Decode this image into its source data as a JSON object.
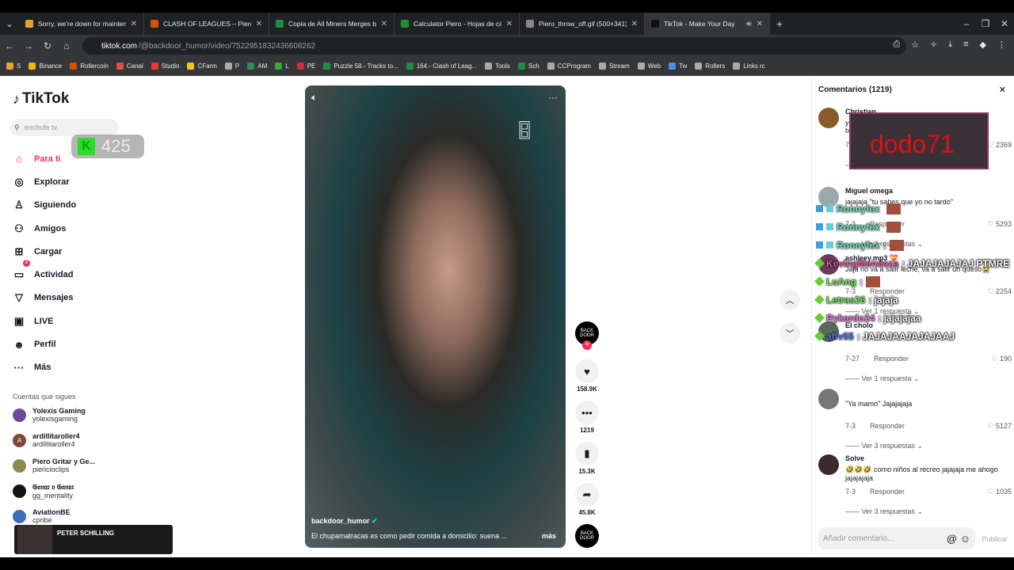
{
  "tabs": [
    {
      "title": "Sorry, we're down for mainten...",
      "color": "#e0a32e"
    },
    {
      "title": "CLASH OF LEAGUES – Piero",
      "color": "#d35400"
    },
    {
      "title": "Copia de All Miners Merges by",
      "color": "#1e8e3e"
    },
    {
      "title": "Calculator Piero - Hojas de cálc",
      "color": "#1e8e3e"
    },
    {
      "title": "Piero_throw_off.gif (500×341)",
      "color": "#888888"
    },
    {
      "title": "TikTok - Make Your Day",
      "color": "#111111"
    }
  ],
  "url": {
    "domain": "tiktok.com",
    "path": "/@backdoor_humor/video/7522951832436608262"
  },
  "bookmarks": [
    "S",
    "Binance",
    "Rollercoin",
    "Canal",
    "Studio",
    "CFarm",
    "P",
    "AM",
    "L",
    "PE",
    "Puzzle 58.- Tracks to...",
    "164.- Clash of Leag...",
    "Tools",
    "Sch",
    "CCProgram",
    "Stream",
    "Web",
    "Tw",
    "Rollers",
    "Links rc"
  ],
  "sidebar": {
    "logo": "TikTok",
    "search_placeholder": "enchufe tv",
    "menu": [
      {
        "label": "Para ti",
        "icon": "⌂"
      },
      {
        "label": "Explorar",
        "icon": "◎"
      },
      {
        "label": "Siguiendo",
        "icon": "♙"
      },
      {
        "label": "Amigos",
        "icon": "⚇"
      },
      {
        "label": "Cargar",
        "icon": "⊞"
      },
      {
        "label": "Actividad",
        "icon": "▭"
      },
      {
        "label": "Mensajes",
        "icon": "▽"
      },
      {
        "label": "LIVE",
        "icon": "▣"
      },
      {
        "label": "Perfil",
        "icon": "☻"
      },
      {
        "label": "Más",
        "icon": "···"
      }
    ],
    "activity_count": "2",
    "following_title": "Cuentas que sigues",
    "accounts": [
      {
        "name": "Yolexis Gaming",
        "handle": "yolexisgaming",
        "initial": "",
        "color": "#6a4c93"
      },
      {
        "name": "ardillitaroller4",
        "handle": "ardillitaroller4",
        "initial": "A",
        "color": "#7a4a3a"
      },
      {
        "name": "Piero Gritar y Ge...",
        "handle": "piericioclips",
        "initial": "",
        "color": "#8a8a50"
      },
      {
        "name": "𝔊𝔞𝔫𝔞𝔯 𝔬 𝔊𝔞𝔫𝔞𝔯",
        "handle": "gg_mentality",
        "initial": "",
        "color": "#111111"
      },
      {
        "name": "AviationBE",
        "handle": "cpnbe",
        "initial": "",
        "color": "#3b6fb5"
      }
    ]
  },
  "overlay_badge": {
    "letter": "K",
    "value": "425"
  },
  "video": {
    "username": "backdoor_humor",
    "description": "El chupamatracas es como pedir comida a domicilio: suena ...",
    "more": "más",
    "likes": "158.9K",
    "comments": "1219",
    "saves": "15.3K",
    "shares": "45.8K",
    "avatar_text": "BACK DOOR"
  },
  "comments_panel": {
    "title": "Comentarios (1219)",
    "input_placeholder": "Añadir comentario...",
    "publish": "Publicar",
    "reply_label": "Responder",
    "items": [
      {
        "name": "Christian",
        "text": "yo se que son profesionales, pero seguro los bloopers estuvieron muy cagados 😂",
        "date": "7-3",
        "likes": "2369",
        "replies": "Ver 1 respuesta",
        "color": "#8b5a2b"
      },
      {
        "name": "Miguel omega",
        "text": "jajajaja \"tu sabes que yo no tardo\"",
        "date": "7-3",
        "likes": "5293",
        "replies": "Ver 2 respuestas",
        "color": "#9aa"
      },
      {
        "name": "ashleey.mp3 💝",
        "text": "Jaja no va a salir leche, va a salir un queso😭",
        "date": "7-3",
        "likes": "2254",
        "replies": "Ver 1 respuesta",
        "color": "#6a3b5a"
      },
      {
        "name": "El cholo",
        "text": "",
        "date": "7-27",
        "likes": "190",
        "replies": "Ver 1 respuesta",
        "color": "#5a6a5a"
      },
      {
        "name": "",
        "text": "\"Ya mamo\" Jajajajaja",
        "date": "7-3",
        "likes": "5127",
        "replies": "Ver 3 respuestas",
        "color": "#777"
      },
      {
        "name": "Solve",
        "text": "🤣🤣🤣 como niños al recreo jajajaja me ahogo jajajajaja",
        "date": "7-3",
        "likes": "1035",
        "replies": "Ver 3 respuestas",
        "color": "#3a2a2a"
      }
    ]
  },
  "chat_overlay": [
    {
      "name": "Ronnyfex",
      "msg": "",
      "color": "#6fe0c0"
    },
    {
      "name": "Ronnyfex",
      "msg": "",
      "color": "#6fe0c0"
    },
    {
      "name": "Ronnyfex",
      "msg": ":",
      "color": "#6fe0c0"
    },
    {
      "name": "KevingMendoza",
      "msg": ": JAJAJAJAJAJ PTMRE",
      "color": "#e05aa0"
    },
    {
      "name": "LuAng",
      "msg": ":",
      "color": "#7be05a"
    },
    {
      "name": "Letras26",
      "msg": ": jajaja",
      "color": "#7be05a"
    },
    {
      "name": "Rykardo24",
      "msg": ": jajajajaa",
      "color": "#e07ad0"
    },
    {
      "name": "affv55",
      "msg": ": JAJAJAAJAJAJAAJ",
      "color": "#5a7ae0"
    }
  ],
  "signature_text": "dodo71",
  "webcam_label": "PETER SCHILLING"
}
